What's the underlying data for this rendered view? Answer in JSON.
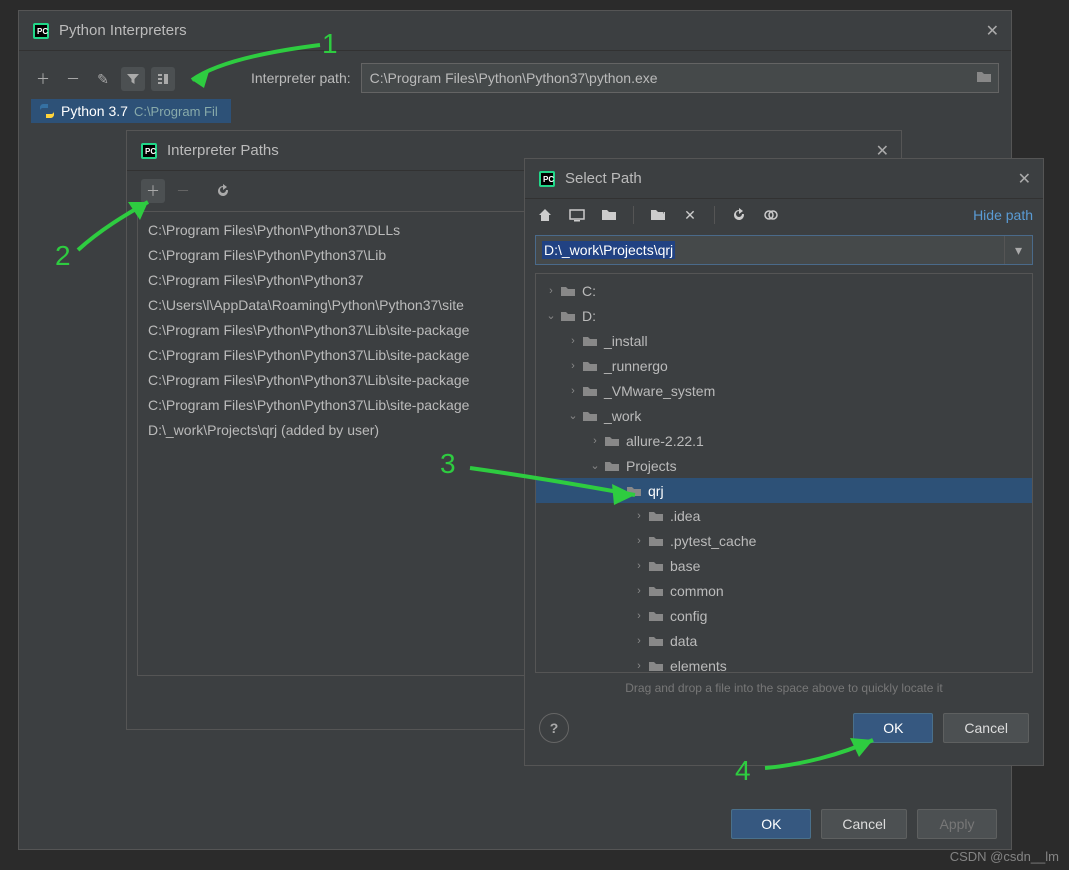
{
  "main": {
    "title": "Python Interpreters",
    "interpreter_name": "Python 3.7",
    "interpreter_hint": "C:\\Program Fil",
    "interpreter_path_label": "Interpreter path:",
    "interpreter_path_value": "C:\\Program Files\\Python\\Python37\\python.exe",
    "ok": "OK",
    "cancel": "Cancel",
    "apply": "Apply"
  },
  "paths": {
    "title": "Interpreter Paths",
    "list": [
      "C:\\Program Files\\Python\\Python37\\DLLs",
      "C:\\Program Files\\Python\\Python37\\Lib",
      "C:\\Program Files\\Python\\Python37",
      "C:\\Users\\l\\AppData\\Roaming\\Python\\Python37\\site",
      "C:\\Program Files\\Python\\Python37\\Lib\\site-package",
      "C:\\Program Files\\Python\\Python37\\Lib\\site-package",
      "C:\\Program Files\\Python\\Python37\\Lib\\site-package",
      "C:\\Program Files\\Python\\Python37\\Lib\\site-package",
      "D:\\_work\\Projects\\qrj  (added by user)"
    ]
  },
  "select": {
    "title": "Select Path",
    "hide_path": "Hide path",
    "path_value": "D:\\_work\\Projects\\qrj",
    "hint_text": "Drag and drop a file into the space above to quickly locate it",
    "ok": "OK",
    "cancel": "Cancel",
    "tree": [
      {
        "indent": 0,
        "expand": "right",
        "name": "C:"
      },
      {
        "indent": 0,
        "expand": "down",
        "name": "D:"
      },
      {
        "indent": 1,
        "expand": "right",
        "name": "_install"
      },
      {
        "indent": 1,
        "expand": "right",
        "name": "_runnergo"
      },
      {
        "indent": 1,
        "expand": "right",
        "name": "_VMware_system"
      },
      {
        "indent": 1,
        "expand": "down",
        "name": "_work"
      },
      {
        "indent": 2,
        "expand": "right",
        "name": "allure-2.22.1"
      },
      {
        "indent": 2,
        "expand": "down",
        "name": "Projects"
      },
      {
        "indent": 3,
        "expand": "down",
        "name": "qrj",
        "selected": true
      },
      {
        "indent": 4,
        "expand": "right",
        "name": ".idea"
      },
      {
        "indent": 4,
        "expand": "right",
        "name": ".pytest_cache"
      },
      {
        "indent": 4,
        "expand": "right",
        "name": "base"
      },
      {
        "indent": 4,
        "expand": "right",
        "name": "common"
      },
      {
        "indent": 4,
        "expand": "right",
        "name": "config"
      },
      {
        "indent": 4,
        "expand": "right",
        "name": "data"
      },
      {
        "indent": 4,
        "expand": "right",
        "name": "elements"
      }
    ]
  },
  "annotations": {
    "n1": "1",
    "n2": "2",
    "n3": "3",
    "n4": "4"
  },
  "watermark": "CSDN @csdn__lm"
}
